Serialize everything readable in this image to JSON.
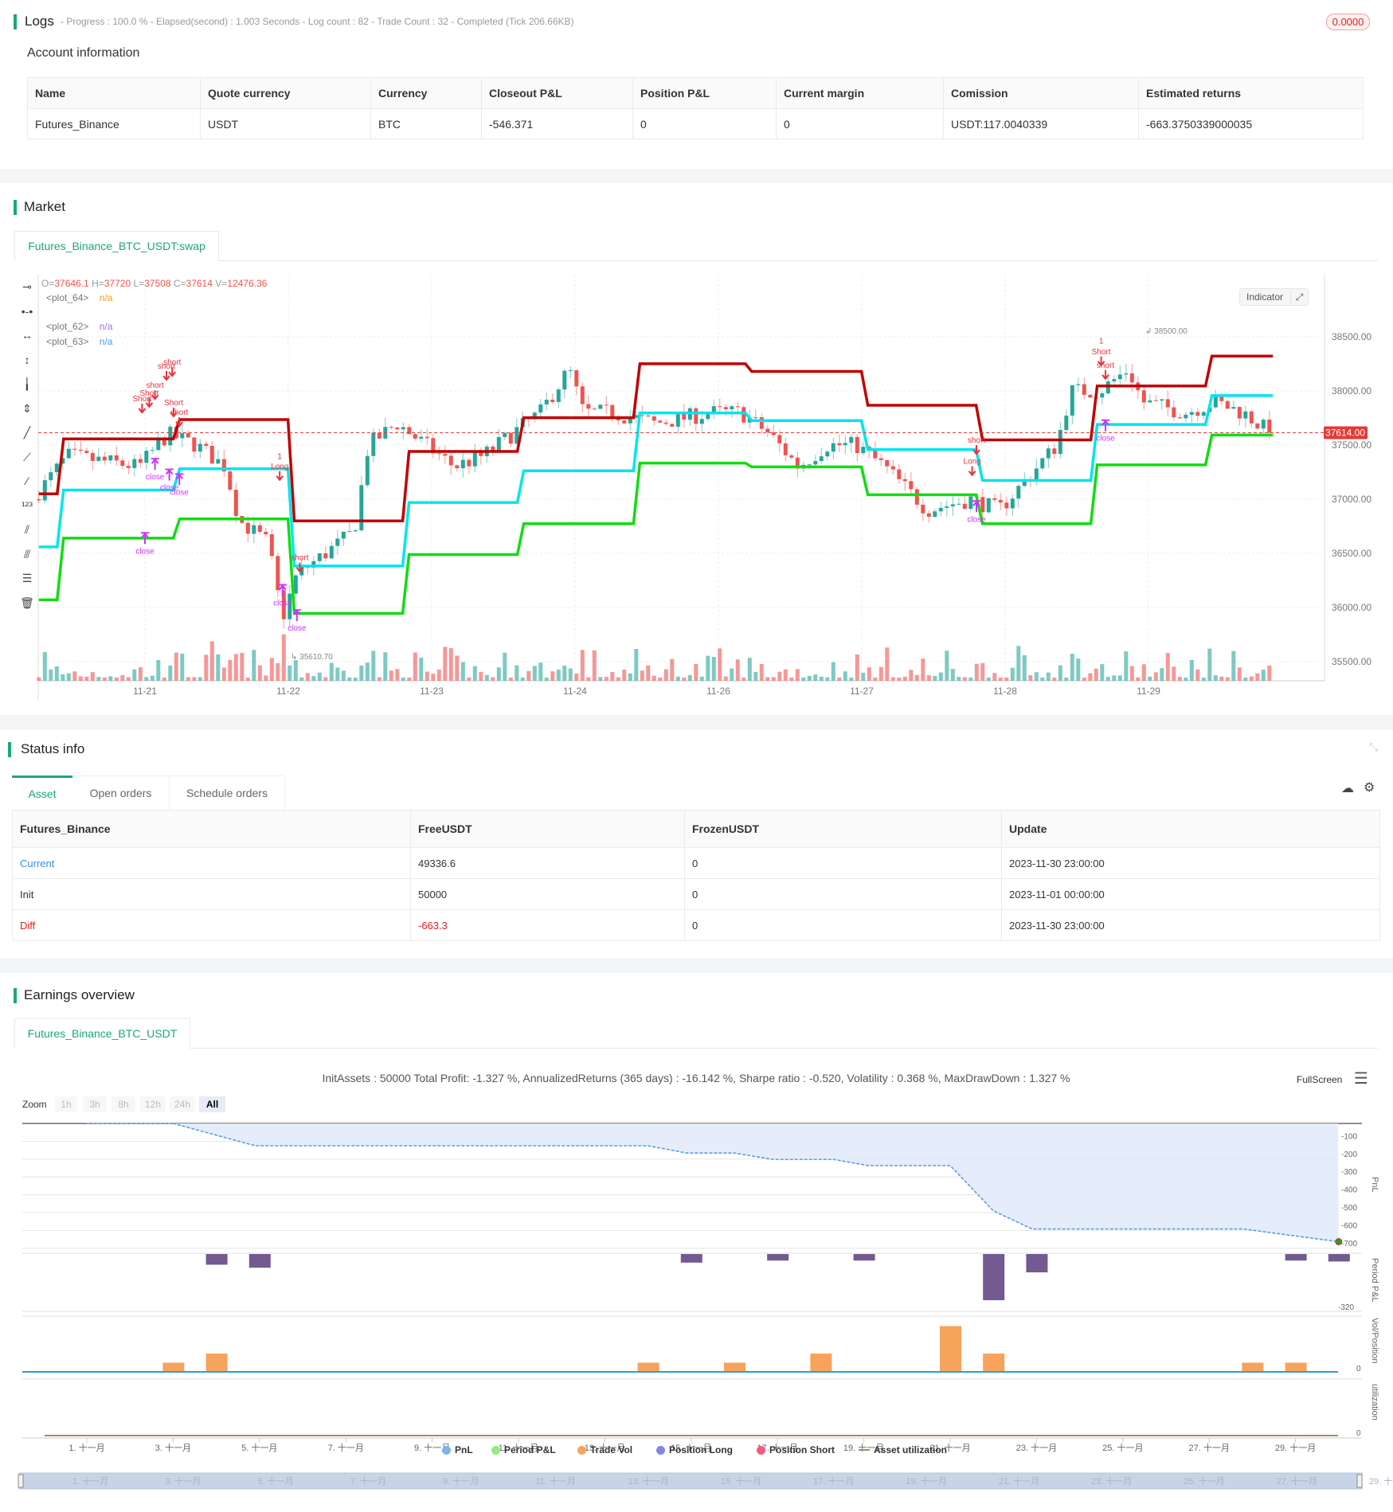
{
  "logs": {
    "title": "Logs",
    "summary": "- Progress : 100.0 % - Elapsed(second) : 1.003  Seconds - Log count : 82 - Trade Count : 32 - Completed (Tick 206.66KB)",
    "badge": "0.0000"
  },
  "account": {
    "title": "Account information",
    "headers": [
      "Name",
      "Quote currency",
      "Currency",
      "Closeout P&L",
      "Position P&L",
      "Current margin",
      "Comission",
      "Estimated returns"
    ],
    "row": [
      "Futures_Binance",
      "USDT",
      "BTC",
      "-546.371",
      "0",
      "0",
      "USDT:117.0040339",
      "-663.3750339000035"
    ]
  },
  "market": {
    "title": "Market",
    "tab": "Futures_Binance_BTC_USDT:swap",
    "ohlc": {
      "o_label": "O=",
      "o": "37646.1",
      "h_label": " H=",
      "h": "37720",
      "l_label": " L=",
      "l": "37508",
      "c_label": " C=",
      "c": "37614",
      "v_label": " V=",
      "v": "12476.36"
    },
    "plots": [
      {
        "name": "<plot_64>",
        "value": "n/a",
        "color": "#f59a23"
      },
      {
        "name": "<plot_62>",
        "value": "n/a",
        "color": "#a56cf0"
      },
      {
        "name": "<plot_63>",
        "value": "n/a",
        "color": "#3aa0ff"
      }
    ],
    "indicator_button": "Indicator",
    "current_price": "37614.00",
    "current_price_value": 37614,
    "high_marker": "38500.00",
    "low_marker": "35610.70",
    "price_ticks": [
      38500,
      38000,
      37500,
      37000,
      36500,
      36000,
      35500
    ],
    "price_tick_labels": [
      "38500.00",
      "38000.00",
      "37500.00",
      "37000.00",
      "36500.00",
      "36000.00",
      "35500.00"
    ],
    "date_labels": [
      "11-21",
      "11-22",
      "11-23",
      "11-24",
      "11-26",
      "11-27",
      "11-28",
      "11-29"
    ],
    "colors": {
      "up": "#26a69a",
      "down": "#ef5350",
      "upper": "#c00000",
      "middle": "#00e5ee",
      "lower": "#11dd11",
      "signal": "#e8323c",
      "close": "#cc33ff"
    },
    "segment_bounds": [
      -0.74,
      -0.59,
      0.22,
      1.02,
      1.82,
      2.62,
      3.43,
      4.21,
      5.02,
      5.82,
      6.62,
      7.42,
      7.89
    ],
    "upper_line": [
      37050,
      37557,
      37735,
      36800,
      37441,
      37753,
      38251,
      38180,
      37868,
      37548,
      38046,
      38322
    ],
    "middle_line": [
      36560,
      37085,
      37281,
      36383,
      36970,
      37263,
      37797,
      37726,
      37459,
      37174,
      37690,
      37957
    ],
    "lower_line": [
      36071,
      36641,
      36818,
      35946,
      36489,
      36774,
      37334,
      37299,
      37041,
      36774,
      37317,
      37593
    ],
    "price_path": [
      [
        -0.74,
        37000
      ],
      [
        -0.5,
        37400
      ],
      [
        0,
        37300
      ],
      [
        0.2,
        37600
      ],
      [
        0.4,
        37500
      ],
      [
        0.6,
        37300
      ],
      [
        0.7,
        36800
      ],
      [
        0.9,
        36600
      ],
      [
        1.0,
        35900
      ],
      [
        1.1,
        36300
      ],
      [
        1.3,
        36500
      ],
      [
        1.5,
        36700
      ],
      [
        1.6,
        37500
      ],
      [
        1.8,
        37700
      ],
      [
        2.0,
        37500
      ],
      [
        2.2,
        37300
      ],
      [
        2.4,
        37400
      ],
      [
        2.6,
        37600
      ],
      [
        2.8,
        37800
      ],
      [
        3.0,
        38200
      ],
      [
        3.1,
        37800
      ],
      [
        3.3,
        37800
      ],
      [
        3.6,
        37700
      ],
      [
        4.0,
        37800
      ],
      [
        4.2,
        37800
      ],
      [
        4.4,
        37600
      ],
      [
        4.6,
        37300
      ],
      [
        4.8,
        37500
      ],
      [
        5.0,
        37500
      ],
      [
        5.2,
        37300
      ],
      [
        5.5,
        36900
      ],
      [
        5.8,
        37000
      ],
      [
        6.0,
        36900
      ],
      [
        6.2,
        37200
      ],
      [
        6.4,
        37500
      ],
      [
        6.5,
        38000
      ],
      [
        6.7,
        38000
      ],
      [
        6.9,
        38200
      ],
      [
        7.0,
        37900
      ],
      [
        7.3,
        37800
      ],
      [
        7.5,
        37900
      ],
      [
        7.7,
        37800
      ],
      [
        7.89,
        37614
      ]
    ],
    "signals": [
      {
        "text": "short",
        "t": 0.19,
        "p": 38242,
        "kind": "signal"
      },
      {
        "text": "short",
        "t": 0.15,
        "p": 38206,
        "kind": "signal"
      },
      {
        "text": "short",
        "t": 0.07,
        "p": 38028,
        "kind": "signal"
      },
      {
        "text": "Short",
        "t": 0.03,
        "p": 37957,
        "kind": "signal"
      },
      {
        "text": "Short",
        "t": -0.02,
        "p": 37904,
        "kind": "signal"
      },
      {
        "text": "Short",
        "t": 0.2,
        "p": 37868,
        "kind": "signal"
      },
      {
        "text": "short",
        "t": 0.24,
        "p": 37779,
        "kind": "signal"
      },
      {
        "text": "close",
        "t": 0.0,
        "p": 36498,
        "kind": "close"
      },
      {
        "text": "close",
        "t": 0.07,
        "p": 37183,
        "kind": "close"
      },
      {
        "text": "close",
        "t": 0.17,
        "p": 37085,
        "kind": "close"
      },
      {
        "text": "close",
        "t": 0.24,
        "p": 37041,
        "kind": "close"
      },
      {
        "text": "1",
        "t": 0.94,
        "p": 37370,
        "kind": "signal"
      },
      {
        "text": "Long",
        "t": 0.94,
        "p": 37281,
        "kind": "signal"
      },
      {
        "text": "short",
        "t": 1.08,
        "p": 36436,
        "kind": "signal"
      },
      {
        "text": "close",
        "t": 0.96,
        "p": 36018,
        "kind": "close"
      },
      {
        "text": "close",
        "t": 1.06,
        "p": 35786,
        "kind": "close"
      },
      {
        "text": "short",
        "t": 5.8,
        "p": 37521,
        "kind": "signal"
      },
      {
        "text": "Long",
        "t": 5.77,
        "p": 37326,
        "kind": "signal"
      },
      {
        "text": "close",
        "t": 5.8,
        "p": 36792,
        "kind": "close"
      },
      {
        "text": "1",
        "t": 6.67,
        "p": 38438,
        "kind": "signal"
      },
      {
        "text": "Short",
        "t": 6.67,
        "p": 38340,
        "kind": "signal"
      },
      {
        "text": "short",
        "t": 6.7,
        "p": 38215,
        "kind": "signal"
      },
      {
        "text": "close",
        "t": 6.7,
        "p": 37539,
        "kind": "close"
      }
    ]
  },
  "status": {
    "title": "Status info",
    "tabs": [
      "Asset",
      "Open orders",
      "Schedule orders"
    ],
    "headers": [
      "Futures_Binance",
      "FreeUSDT",
      "FrozenUSDT",
      "Update"
    ],
    "rows": [
      [
        "Current",
        "49336.6",
        "0",
        "2023-11-30 23:00:00"
      ],
      [
        "Init",
        "50000",
        "0",
        "2023-11-01 00:00:00"
      ],
      [
        "Diff",
        "-663.3",
        "0",
        "2023-11-30 23:00:00"
      ]
    ]
  },
  "earnings": {
    "title": "Earnings overview",
    "tab": "Futures_Binance_BTC_USDT",
    "stats": "InitAssets : 50000 Total Profit: -1.327 %, AnnualizedReturns (365 days) : -16.142 %, Sharpe ratio : -0.520, Volatility : 0.368 %, MaxDrawDown : 1.327 %",
    "fullscreen": "FullScreen",
    "zoom_label": "Zoom",
    "zoom_buttons": [
      "1h",
      "3h",
      "8h",
      "12h",
      "24h",
      "All"
    ],
    "panel_titles": [
      "PnL",
      "Period P&L",
      "Vol/Position",
      "utilization"
    ],
    "pnl_ticks": [
      "-100",
      "-200",
      "-300",
      "-400",
      "-500",
      "-600",
      "-700"
    ],
    "period_tick": "-320",
    "vol_tick": "0",
    "util_tick": "0",
    "x_labels": [
      "1. 十一月",
      "3. 十一月",
      "5. 十一月",
      "7. 十一月",
      "9. 十一月",
      "11. 十一月",
      "13. 十一月",
      "15. 十一月",
      "17. 十一月",
      "19. 十一月",
      "21. 十一月",
      "23. 十一月",
      "25. 十一月",
      "27. 十一月",
      "29. 十一月"
    ],
    "legend": [
      {
        "label": "PnL",
        "color": "#7cb5ec"
      },
      {
        "label": "Period P&L",
        "color": "#90ed7d"
      },
      {
        "label": "Trade Vol",
        "color": "#f7a35c"
      },
      {
        "label": "Position Long",
        "color": "#8085e9"
      },
      {
        "label": "Position Short",
        "color": "#f15c80"
      },
      {
        "label": "Asset utilization",
        "color": "#a09060"
      }
    ],
    "chart_data": {
      "pnl": [
        [
          1,
          0
        ],
        [
          3,
          0
        ],
        [
          4.9,
          -125
        ],
        [
          14.0,
          -125
        ],
        [
          14.9,
          -166
        ],
        [
          16.0,
          -166
        ],
        [
          16.9,
          -202
        ],
        [
          18.3,
          -202
        ],
        [
          19.1,
          -236
        ],
        [
          21.0,
          -236
        ],
        [
          22.0,
          -490
        ],
        [
          22.9,
          -592
        ],
        [
          27.8,
          -592
        ],
        [
          30,
          -663
        ]
      ],
      "period_pnl": [
        [
          4,
          -67
        ],
        [
          5,
          -86
        ],
        [
          15,
          -54
        ],
        [
          17,
          -41
        ],
        [
          19,
          -41
        ],
        [
          22,
          -290
        ],
        [
          23,
          -115
        ],
        [
          29,
          -41
        ],
        [
          30,
          -47
        ]
      ],
      "trade_vol": [
        [
          3,
          1
        ],
        [
          4,
          2
        ],
        [
          14,
          1
        ],
        [
          16,
          1
        ],
        [
          18,
          2
        ],
        [
          21,
          5
        ],
        [
          22,
          2
        ],
        [
          28,
          1
        ],
        [
          29,
          1
        ]
      ]
    }
  }
}
